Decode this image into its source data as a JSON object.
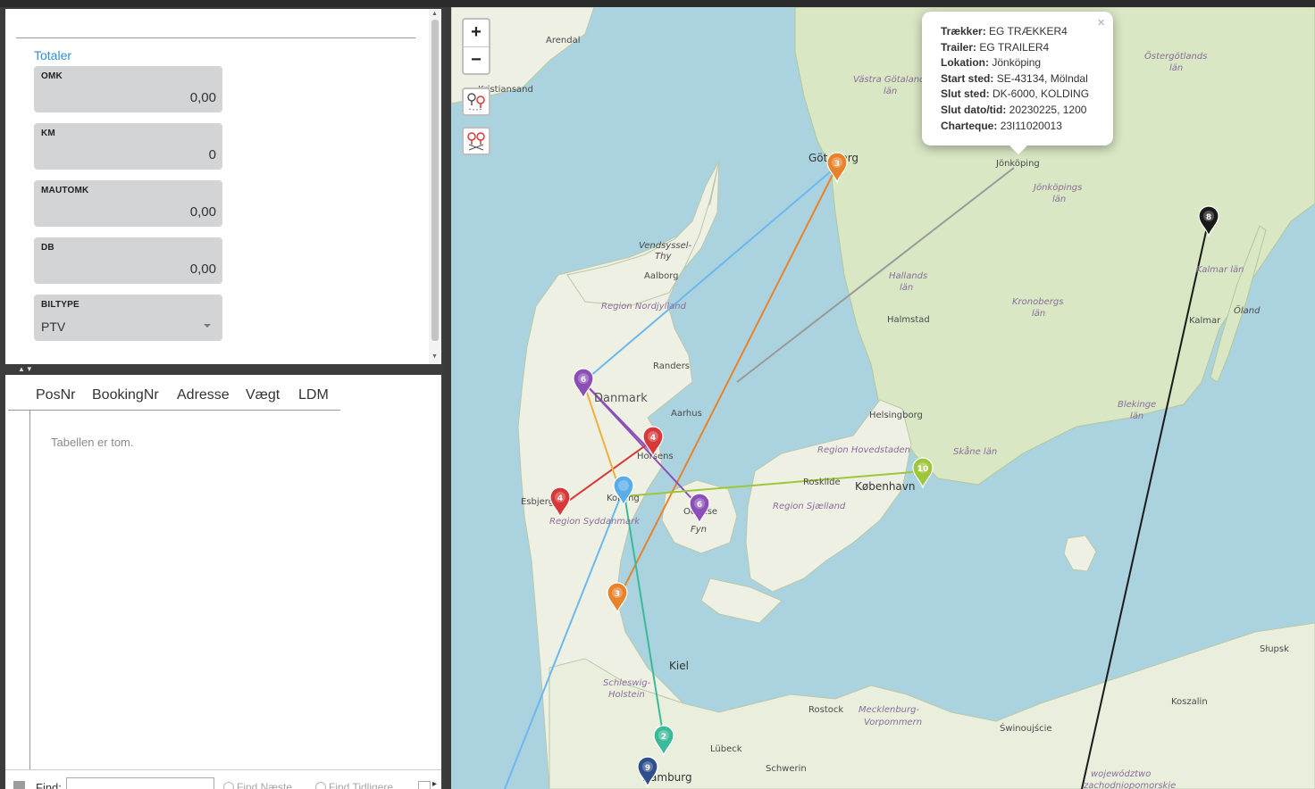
{
  "totals": {
    "title": "Totaler",
    "fields": [
      {
        "label": "OMK",
        "value": "0,00"
      },
      {
        "label": "KM",
        "value": "0"
      },
      {
        "label": "MAUTOMK",
        "value": "0,00"
      },
      {
        "label": "DB",
        "value": "0,00"
      }
    ],
    "biltype": {
      "label": "BILTYPE",
      "value": "PTV"
    }
  },
  "table": {
    "columns": [
      "PosNr",
      "BookingNr",
      "Adresse",
      "Vægt",
      "LDM"
    ],
    "empty_text": "Tabellen er tom."
  },
  "find_bar": {
    "label": "Find:",
    "next_label": "Find Næste",
    "prev_label": "Find Tidligere"
  },
  "map": {
    "zoom_in": "+",
    "zoom_out": "−",
    "popup": {
      "rows": [
        {
          "key": "Trækker:",
          "value": "EG TRÆKKER4"
        },
        {
          "key": "Trailer:",
          "value": "EG TRAILER4"
        },
        {
          "key": "Lokation:",
          "value": "Jönköping"
        },
        {
          "key": "Start sted:",
          "value": "SE-43134, Mölndal"
        },
        {
          "key": "Slut sted:",
          "value": "DK-6000, KOLDING"
        },
        {
          "key": "Slut dato/tid:",
          "value": "20230225, 1200"
        },
        {
          "key": "Charteque:",
          "value": "23I11020013"
        }
      ],
      "close": "×"
    },
    "places": {
      "arendal": "Arendal",
      "kristiansand": "Kristiansand",
      "vastra_gotaland": "Västra Götalands",
      "vastra_gotaland2": "län",
      "goteborg": "Göteborg",
      "jonkoping": "Jönköping",
      "jonkopings_lan": "Jönköpings",
      "jonkopings_lan2": "län",
      "ostergotlands": "Östergötlands",
      "ostergotlands2": "län",
      "vendsyssel": "Vendsyssel-",
      "vendsyssel2": "Thy",
      "aalborg": "Aalborg",
      "region_nordjylland": "Region Nordjylland",
      "hallands": "Hallands",
      "hallands2": "län",
      "kronobergs": "Kronobergs",
      "kronobergs2": "län",
      "kalmar_lan": "Kalmar län",
      "kalmar": "Kalmar",
      "oland": "Öland",
      "halmstad": "Halmstad",
      "randers": "Randers",
      "danmark": "Danmark",
      "aarhus": "Aarhus",
      "helsingborg": "Helsingborg",
      "blekinge": "Blekinge",
      "blekinge2": "län",
      "horsens": "Horsens",
      "region_hovedstaden": "Region Hovedstaden",
      "skane": "Skåne län",
      "roskilde": "Roskilde",
      "kobenhavn": "København",
      "esbjerg": "Esbjerg",
      "kolding": "Kolding",
      "odense": "Odense",
      "region_syddanmark": "Region Syddanmark",
      "region_sjaelland": "Region Sjælland",
      "fyn": "Fyn",
      "kiel": "Kiel",
      "schleswig": "Schleswig-",
      "holstein": "Holstein",
      "rostock": "Rostock",
      "mecklenburg": "Mecklenburg-",
      "vorpommern": "Vorpommern",
      "swinoujscie": "Świnoujście",
      "lubeck": "Lübeck",
      "schwerin": "Schwerin",
      "hamburg": "Hamburg",
      "slupsk": "Słupsk",
      "koszalin": "Koszalin",
      "wojewodztwo": "województwo",
      "zachodniopomorskie": "zachodniopomorskie"
    },
    "markers": [
      {
        "label": "3",
        "color": "#e8822b"
      },
      {
        "label": "8",
        "color": "#1a1a1a"
      },
      {
        "label": "6",
        "color": "#8c4fb8"
      },
      {
        "label": "4",
        "color": "#d93838"
      },
      {
        "label": "10",
        "color": "#9dc63b"
      },
      {
        "label": "6",
        "color": "#8c4fb8"
      },
      {
        "label": "4",
        "color": "#d93838"
      },
      {
        "label": "",
        "color": "#5aaee8"
      },
      {
        "label": "3",
        "color": "#e8822b"
      },
      {
        "label": "2",
        "color": "#3aba9a"
      },
      {
        "label": "9",
        "color": "#2f4e8c"
      }
    ],
    "route_colors": [
      "#6bb8f0",
      "#e8822b",
      "#1a1a1a",
      "#8c4fb8",
      "#d93838",
      "#9dc63b",
      "#3aba9a",
      "#f0b03c"
    ]
  }
}
